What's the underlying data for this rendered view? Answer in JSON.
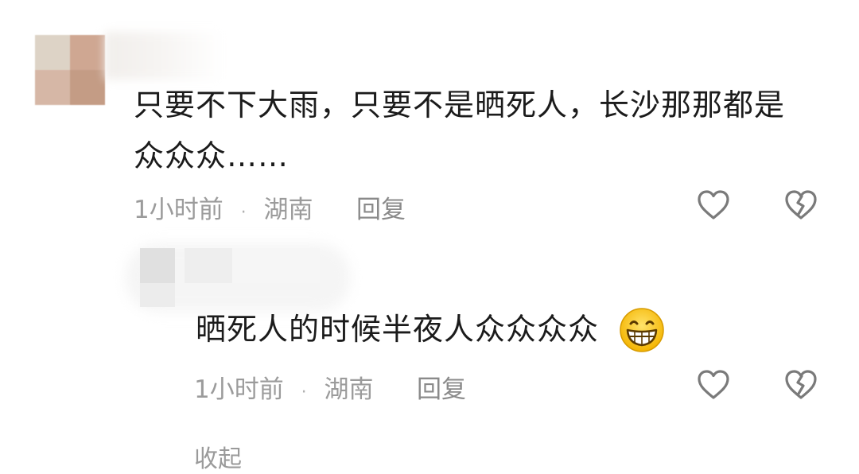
{
  "comments": [
    {
      "text_line1": "只要不下大雨，只要不是晒死人，长沙那那都是",
      "text_line2": "众众众……",
      "time": "1小时前",
      "separator": "·",
      "location": "湖南",
      "reply_label": "回复"
    },
    {
      "text": "晒死人的时候半夜人众众众众",
      "time": "1小时前",
      "separator": "·",
      "location": "湖南",
      "reply_label": "回复",
      "emoji": "grinning-face"
    }
  ],
  "collapse_label": "收起",
  "icons": {
    "like": "heart-outline-icon",
    "dislike": "broken-heart-icon"
  },
  "colors": {
    "text": "#1b1b1b",
    "meta": "#9b9b9b",
    "icon": "#7a7a7a"
  }
}
